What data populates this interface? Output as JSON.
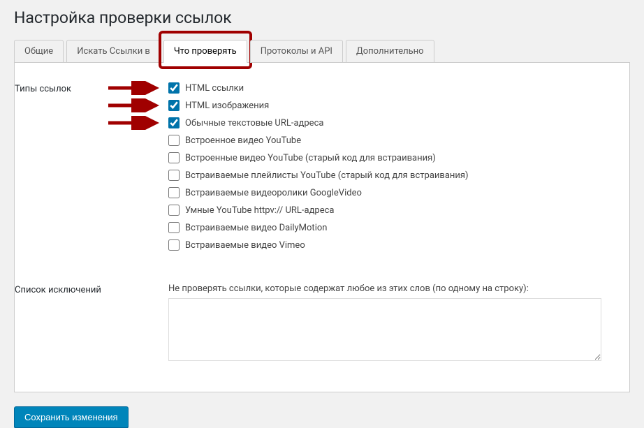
{
  "page": {
    "title": "Настройка проверки ссылок"
  },
  "tabs": [
    {
      "label": "Общие"
    },
    {
      "label": "Искать Ссылки в"
    },
    {
      "label": "Что проверять"
    },
    {
      "label": "Протоколы и API"
    },
    {
      "label": "Дополнительно"
    }
  ],
  "sections": {
    "link_types": {
      "heading": "Типы ссылок",
      "options": [
        {
          "label": "HTML ссылки",
          "checked": true,
          "highlight": true
        },
        {
          "label": "HTML изображения",
          "checked": true,
          "highlight": true
        },
        {
          "label": "Обычные текстовые URL-адреса",
          "checked": true,
          "highlight": true
        },
        {
          "label": "Встроенное видео YouTube",
          "checked": false,
          "highlight": false
        },
        {
          "label": "Встроенные видео YouTube (старый код для встраивания)",
          "checked": false,
          "highlight": false
        },
        {
          "label": "Встраиваемые плейлисты YouTube (старый код для встраивания)",
          "checked": false,
          "highlight": false
        },
        {
          "label": "Встраиваемые видеоролики GoogleVideo",
          "checked": false,
          "highlight": false
        },
        {
          "label": "Умные YouTube httpv:// URL-адреса",
          "checked": false,
          "highlight": false
        },
        {
          "label": "Встраиваемые видео DailyMotion",
          "checked": false,
          "highlight": false
        },
        {
          "label": "Встраиваемые видео Vimeo",
          "checked": false,
          "highlight": false
        }
      ]
    },
    "exclusions": {
      "heading": "Список исключений",
      "description": "Не проверять ссылки, которые содержат любое из этих слов (по одному на строку):",
      "value": ""
    }
  },
  "submit": {
    "label": "Сохранить изменения"
  }
}
